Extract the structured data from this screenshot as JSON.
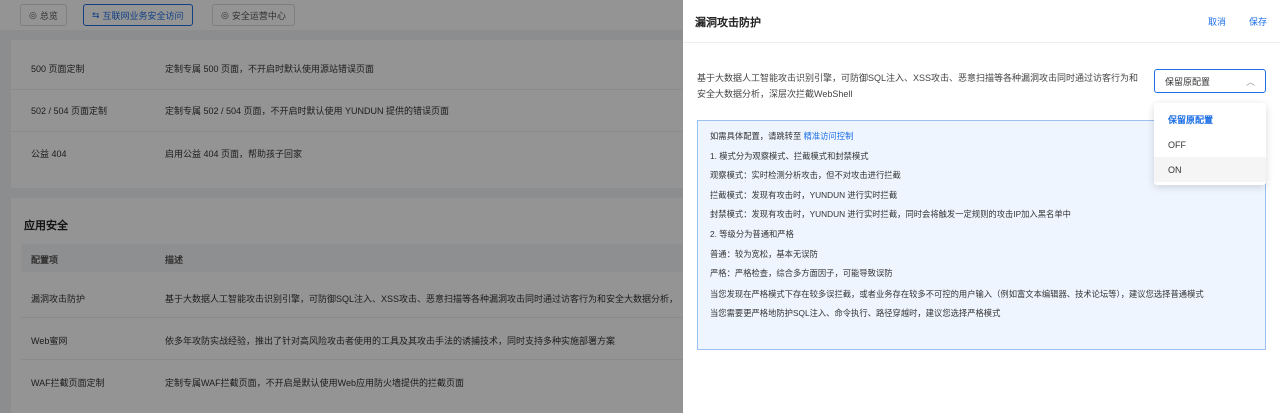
{
  "topbar": {
    "tabs": [
      {
        "icon": "◎",
        "label": "总览"
      },
      {
        "icon": "⇆",
        "label": "互联网业务安全访问"
      },
      {
        "icon": "◎",
        "label": "安全运营中心"
      }
    ]
  },
  "page_rows": [
    {
      "name": "500 页面定制",
      "desc": "定制专属 500 页面，不开启时默认使用源站错误页面"
    },
    {
      "name": "502 / 504 页面定制",
      "desc": "定制专属 502 / 504 页面，不开启时默认使用 YUNDUN 提供的错误页面"
    },
    {
      "name": "公益 404",
      "desc": "启用公益 404 页面，帮助孩子回家"
    }
  ],
  "app_security": {
    "title": "应用安全",
    "columns": [
      "配置项",
      "描述"
    ],
    "rows": [
      {
        "name": "漏洞攻击防护",
        "desc": "基于大数据人工智能攻击识别引擎，可防御SQL注入、XSS攻击、恶意扫描等各种漏洞攻击同时通过访客行为和安全大数据分析，"
      },
      {
        "name": "Web蜜网",
        "desc": "依多年攻防实战经验，推出了针对高风险攻击者使用的工具及其攻击手法的诱捕技术，同时支持多种实施部署方案"
      },
      {
        "name": "WAF拦截页面定制",
        "desc": "定制专属WAF拦截页面，不开启是默认使用Web应用防火墙提供的拦截页面"
      }
    ]
  },
  "drawer": {
    "title": "漏洞攻击防护",
    "cancel": "取消",
    "save": "保存",
    "description": "基于大数据人工智能攻击识别引擎，可防御SQL注入、XSS攻击、恶意扫描等各种漏洞攻击同时通过访客行为和安全大数据分析，深层次拦截WebShell",
    "select": {
      "value": "保留原配置",
      "options": [
        "保留原配置",
        "OFF",
        "ON"
      ]
    },
    "info": {
      "intro": "如需具体配置，请跳转至 ",
      "link": "精准访问控制",
      "lines": [
        "1. 模式分为观察模式、拦截模式和封禁模式",
        "观察模式：实时检测分析攻击，但不对攻击进行拦截",
        "拦截模式：发现有攻击时，YUNDUN 进行实时拦截",
        "封禁模式：发现有攻击时，YUNDUN 进行实时拦截，同时会将触发一定规则的攻击IP加入黑名单中",
        "2. 等级分为普通和严格",
        "普通：较为宽松，基本无误防",
        "严格：严格检查，综合多方面因子，可能导致误防"
      ],
      "wrap_line": "当您发现在严格模式下存在较多误拦截，或者业务存在较多不可控的用户输入（例如富文本编辑器、技术论坛等），建议您选择普通模式",
      "last_line": "当您需要更严格地防护SQL注入、命令执行、路径穿越时，建议您选择严格模式"
    }
  }
}
